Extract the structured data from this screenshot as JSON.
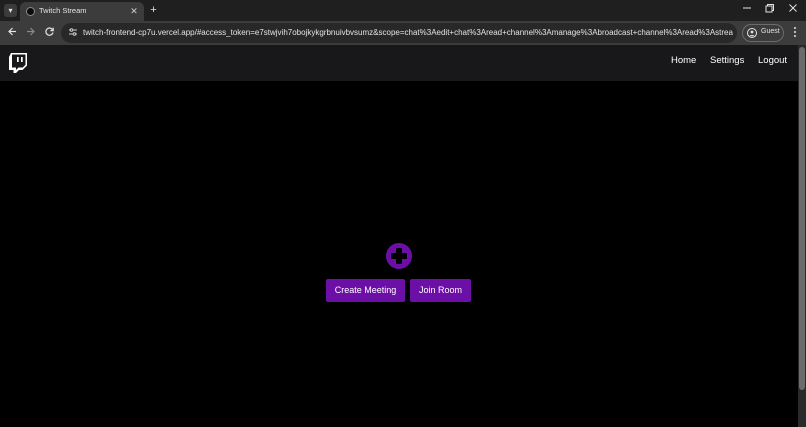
{
  "browser": {
    "tab": {
      "title": "Twitch Stream",
      "close_glyph": "✕"
    },
    "new_tab_glyph": "+",
    "url": "twitch-frontend-cp7u.vercel.app/#access_token=e7stwjvih7obojkykgrbnuivbvsumz&scope=chat%3Aedit+chat%3Aread+channel%3Amanage%3Abroadcast+channel%3Aread%3Astream_key+clips...",
    "profile_label": "Guest",
    "icons": [
      "tab-list-icon",
      "back-icon",
      "forward-icon",
      "reload-icon",
      "site-info-icon",
      "profile-icon",
      "menu-icon",
      "minimize-icon",
      "maximize-icon",
      "close-icon"
    ]
  },
  "app": {
    "nav": {
      "home": "Home",
      "settings": "Settings",
      "logout": "Logout"
    },
    "actions": {
      "create_meeting": "Create Meeting",
      "join_room": "Join Room"
    },
    "colors": {
      "accent": "#6c0fa6",
      "navbar": "#18181b",
      "background": "#000000"
    }
  }
}
